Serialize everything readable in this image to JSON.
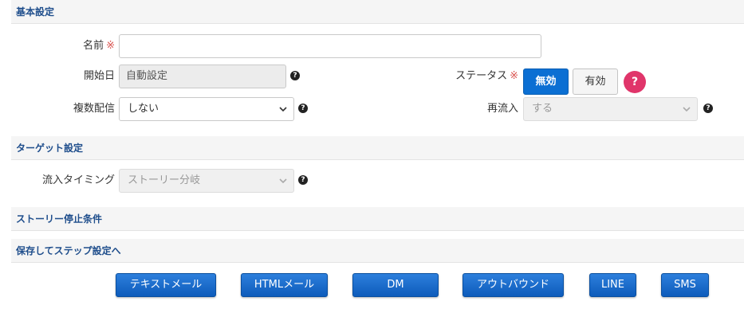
{
  "sections": {
    "basic": "基本設定",
    "target": "ターゲット設定",
    "story_stop": "ストーリー停止条件",
    "save_step": "保存してステップ設定へ"
  },
  "form": {
    "name_label": "名前",
    "required_mark": "※",
    "name_value": "",
    "start_date_label": "開始日",
    "start_date_value": "自動設定",
    "status_label": "ステータス",
    "status_inactive": "無効",
    "status_active": "有効",
    "status_selected": "無効",
    "multi_delivery_label": "複数配信",
    "multi_delivery_value": "しない",
    "reentry_label": "再流入",
    "reentry_value": "する",
    "inflow_timing_label": "流入タイミング",
    "inflow_timing_value": "ストーリー分岐",
    "help_glyph": "?"
  },
  "actions": {
    "text_mail": "テキストメール",
    "html_mail": "HTMLメール",
    "dm": "DM",
    "outbound": "アウトバウンド",
    "line": "LINE",
    "sms": "SMS"
  },
  "colors": {
    "section_title": "#1f4e8c",
    "primary_button": "#0b6fd3",
    "required": "#d9534f",
    "help_badge": "#e0356a"
  }
}
